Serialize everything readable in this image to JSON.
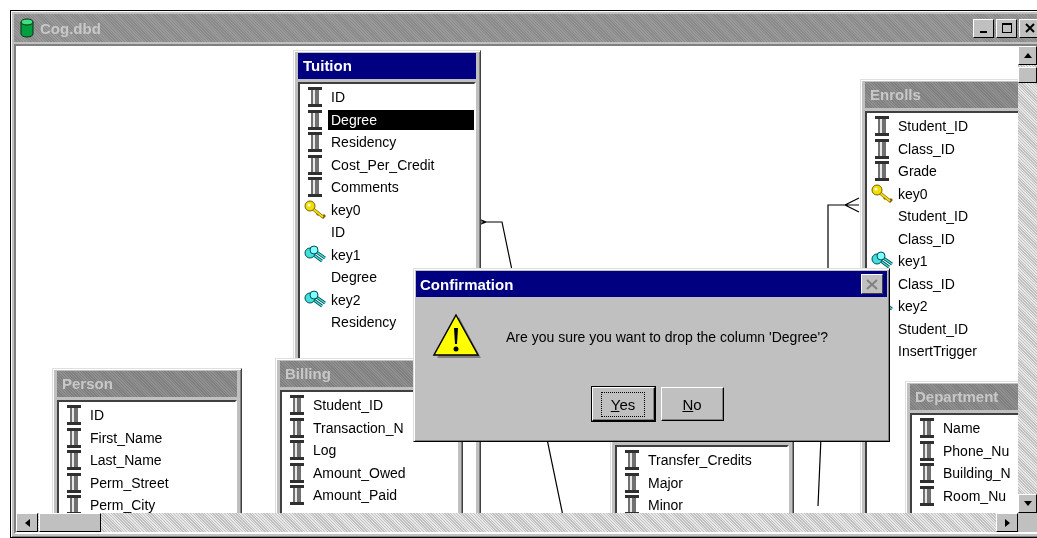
{
  "window": {
    "title": "Cog.dbd"
  },
  "tables": [
    {
      "name": "Tuition",
      "active": true,
      "rows": [
        {
          "text": "ID",
          "kind": "column",
          "selected": false
        },
        {
          "text": "Degree",
          "kind": "column",
          "selected": true
        },
        {
          "text": "Residency",
          "kind": "column",
          "selected": false
        },
        {
          "text": "Cost_Per_Credit",
          "kind": "column",
          "selected": false
        },
        {
          "text": "Comments",
          "kind": "column",
          "selected": false
        },
        {
          "text": "key0",
          "kind": "primary-key",
          "selected": false
        },
        {
          "text": "ID",
          "kind": "field",
          "selected": false
        },
        {
          "text": "key1",
          "kind": "index",
          "selected": false
        },
        {
          "text": "Degree",
          "kind": "field",
          "selected": false
        },
        {
          "text": "key2",
          "kind": "index",
          "selected": false
        },
        {
          "text": "Residency",
          "kind": "field",
          "selected": false
        }
      ]
    },
    {
      "name": "Enrolls",
      "active": false,
      "rows": [
        {
          "text": "Student_ID",
          "kind": "column",
          "selected": false
        },
        {
          "text": "Class_ID",
          "kind": "column",
          "selected": false
        },
        {
          "text": "Grade",
          "kind": "column",
          "selected": false
        },
        {
          "text": "key0",
          "kind": "primary-key",
          "selected": false
        },
        {
          "text": "Student_ID",
          "kind": "field",
          "selected": false
        },
        {
          "text": "Class_ID",
          "kind": "field",
          "selected": false
        },
        {
          "text": "key1",
          "kind": "index",
          "selected": false
        },
        {
          "text": "Class_ID",
          "kind": "field",
          "selected": false
        },
        {
          "text": "key2",
          "kind": "index",
          "selected": false
        },
        {
          "text": "Student_ID",
          "kind": "field",
          "selected": false
        },
        {
          "text": "InsertTrigger",
          "kind": "trigger",
          "selected": false
        }
      ]
    },
    {
      "name": "Person",
      "active": false,
      "rows": [
        {
          "text": "ID",
          "kind": "column",
          "selected": false
        },
        {
          "text": "First_Name",
          "kind": "column",
          "selected": false
        },
        {
          "text": "Last_Name",
          "kind": "column",
          "selected": false
        },
        {
          "text": "Perm_Street",
          "kind": "column",
          "selected": false
        },
        {
          "text": "Perm_City",
          "kind": "column",
          "selected": false
        }
      ]
    },
    {
      "name": "Billing",
      "active": false,
      "rows": [
        {
          "text": "Student_ID",
          "kind": "column",
          "selected": false
        },
        {
          "text": "Transaction_N",
          "kind": "column",
          "selected": false
        },
        {
          "text": "Log",
          "kind": "column",
          "selected": false
        },
        {
          "text": "Amount_Owed",
          "kind": "column",
          "selected": false
        },
        {
          "text": "Amount_Paid",
          "kind": "column",
          "selected": false
        }
      ]
    },
    {
      "active": false,
      "rows": [
        {
          "text": "Transfer_Credits",
          "kind": "column",
          "selected": false
        },
        {
          "text": "Major",
          "kind": "column",
          "selected": false
        },
        {
          "text": "Minor",
          "kind": "column",
          "selected": false
        }
      ]
    },
    {
      "name": "Department",
      "active": false,
      "rows": [
        {
          "text": "Name",
          "kind": "column",
          "selected": false
        },
        {
          "text": "Phone_Nu",
          "kind": "column",
          "selected": false
        },
        {
          "text": "Building_N",
          "kind": "column",
          "selected": false
        },
        {
          "text": "Room_Nu",
          "kind": "column",
          "selected": false
        }
      ]
    }
  ],
  "dialog": {
    "title": "Confirmation",
    "message": "Are you sure you want to drop the column 'Degree'?",
    "buttons": [
      {
        "label": "Yes",
        "default": true
      },
      {
        "label": "No",
        "default": false
      }
    ]
  }
}
